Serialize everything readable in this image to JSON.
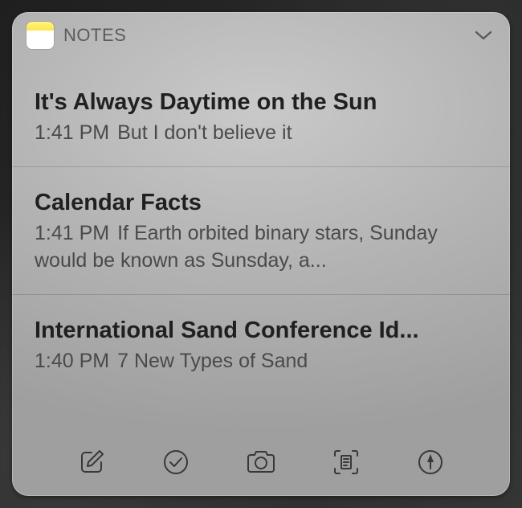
{
  "header": {
    "app_title": "NOTES"
  },
  "notes": [
    {
      "title": "It's Always Daytime on the Sun",
      "time": "1:41 PM",
      "preview": "But I don't believe it"
    },
    {
      "title": "Calendar Facts",
      "time": "1:41 PM",
      "preview": "If Earth orbited binary stars, Sunday would be known as Sunsday, a..."
    },
    {
      "title": "International Sand Conference Id...",
      "time": "1:40 PM",
      "preview": "7 New Types of Sand"
    }
  ],
  "toolbar": {
    "compose": "compose",
    "checklist": "checklist",
    "camera": "camera",
    "scan": "scan-document",
    "markup": "markup"
  }
}
